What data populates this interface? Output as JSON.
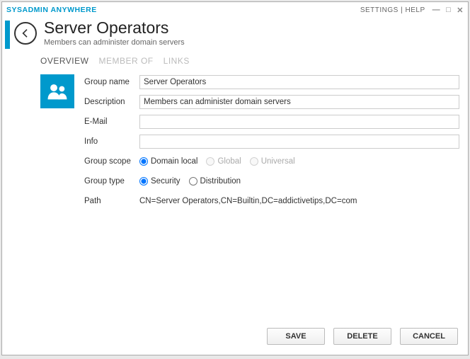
{
  "titlebar": {
    "app_name": "SYSADMIN ANYWHERE",
    "links_text": "SETTINGS | HELP"
  },
  "header": {
    "title": "Server Operators",
    "subtitle": "Members can administer domain servers"
  },
  "tabs": {
    "overview": "OVERVIEW",
    "member_of": "MEMBER OF",
    "links": "LINKS"
  },
  "form": {
    "labels": {
      "group_name": "Group name",
      "description": "Description",
      "email": "E-Mail",
      "info": "Info",
      "group_scope": "Group scope",
      "group_type": "Group type",
      "path": "Path"
    },
    "values": {
      "group_name": "Server Operators",
      "description": "Members can administer domain servers",
      "email": "",
      "info": "",
      "path": "CN=Server Operators,CN=Builtin,DC=addictivetips,DC=com"
    },
    "scope_options": {
      "domain_local": "Domain local",
      "global": "Global",
      "universal": "Universal"
    },
    "type_options": {
      "security": "Security",
      "distribution": "Distribution"
    }
  },
  "buttons": {
    "save": "SAVE",
    "delete": "DELETE",
    "cancel": "CANCEL"
  }
}
